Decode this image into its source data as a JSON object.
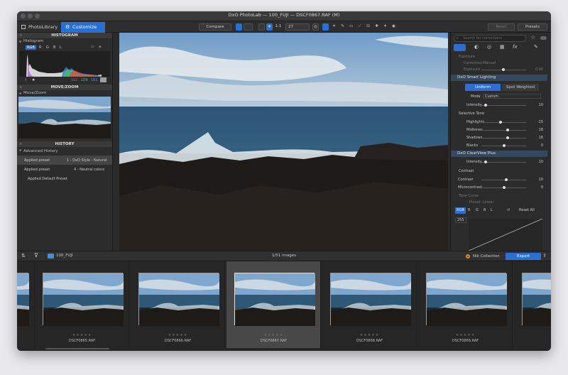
{
  "window": {
    "title": "DxO PhotoLab — 100_FUJI — DSCF0867.RAF (M)"
  },
  "toolbar": {
    "photolibrary": "PhotoLibrary",
    "customize": "Customize",
    "compare": "Compare",
    "zoom_fit": "1:1",
    "zoom_value": "27",
    "reset": "Reset",
    "presets": "Presets"
  },
  "left": {
    "histogram_title": "HISTOGRAM",
    "histogram_sub": "Histogram",
    "channels": [
      "RGB",
      "R",
      "G",
      "B",
      "L"
    ],
    "rgb_values": {
      "r": "152",
      "g": "159",
      "b": "161"
    },
    "movezoom_title": "MOVE/ZOOM",
    "movezoom_sub": "Move/Zoom",
    "history_title": "HISTORY",
    "history_sub": "Advanced History",
    "history_items": [
      {
        "action": "Applied preset",
        "detail": "1 - DxO Style - Natural"
      },
      {
        "action": "Applied preset",
        "detail": "4 - Neutral colors"
      },
      {
        "action": "Applied Default Preset",
        "detail": ""
      }
    ]
  },
  "right": {
    "search_placeholder": "Search for corrections",
    "exposure": {
      "title": "Exposure",
      "correction_label": "Correction",
      "correction_value": "Manual",
      "exposure_label": "Exposure",
      "exposure_value": "0.00"
    },
    "smart_lighting": {
      "title": "DxO Smart Lighting",
      "uniform": "Uniform",
      "spot": "Spot Weighted",
      "mode_label": "Mode",
      "mode_value": "Custom",
      "intensity_label": "Intensity",
      "intensity_value": "10"
    },
    "selective_tone": {
      "title": "Selective Tone",
      "rows": [
        {
          "label": "Highlights",
          "value": "-15",
          "level": 0.42
        },
        {
          "label": "Midtones",
          "value": "18",
          "level": 0.59
        },
        {
          "label": "Shadows",
          "value": "18",
          "level": 0.59
        },
        {
          "label": "Blacks",
          "value": "0",
          "level": 0.5
        }
      ]
    },
    "clearview": {
      "title": "DxO ClearView Plus",
      "intensity_label": "Intensity",
      "intensity_value": "10",
      "level": 0.1
    },
    "contrast": {
      "title": "Contrast",
      "rows": [
        {
          "label": "Contrast",
          "value": "10",
          "level": 0.55
        },
        {
          "label": "Microcontrast",
          "value": "0",
          "level": 0.5
        }
      ]
    },
    "tone_curve": {
      "title": "Tone Curve",
      "preset_label": "Preset",
      "preset_value": "Linear",
      "channels": [
        "RGB",
        "R",
        "G",
        "B",
        "L"
      ],
      "reset_all": "Reset All",
      "top_value": "255"
    }
  },
  "filmstrip": {
    "folder": "100_FUJI",
    "count": "1/51 images",
    "nik": "Nik Collection",
    "export": "Export",
    "items": [
      {
        "name": ""
      },
      {
        "name": "DSCF0865.RAF"
      },
      {
        "name": "DSCF0866.RAF"
      },
      {
        "name": "DSCF0867.RAF",
        "selected": true
      },
      {
        "name": "DSCF0868.RAF"
      },
      {
        "name": "DSCF0869.RAF"
      },
      {
        "name": ""
      }
    ]
  },
  "colors": {
    "accent": "#2a6fd1",
    "sky": "#8fb3d6",
    "sea": "#3d6a8c",
    "rock": "#1f1c1a"
  }
}
